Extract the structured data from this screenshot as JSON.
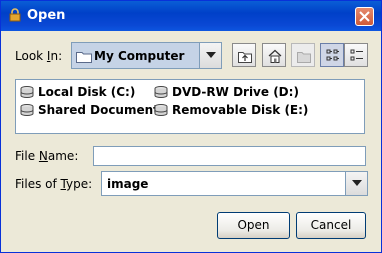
{
  "window": {
    "title": "Open",
    "accent": "#0a4bd4"
  },
  "lookin": {
    "label_pre": "Look ",
    "label_mn": "I",
    "label_post": "n:",
    "value": "My Computer"
  },
  "toolbar": {
    "icons": [
      "up-folder-icon",
      "home-icon",
      "new-folder-icon",
      "list-view-icon",
      "details-view-icon"
    ]
  },
  "files": [
    {
      "name": "Local Disk (C:)"
    },
    {
      "name": "Shared Documents"
    },
    {
      "name": "DVD-RW Drive (D:)"
    },
    {
      "name": "Removable Disk (E:)"
    }
  ],
  "filename": {
    "label_pre": "File ",
    "label_mn": "N",
    "label_post": "ame:",
    "value": ""
  },
  "filetype": {
    "label_pre": "Files of ",
    "label_mn": "T",
    "label_post": "ype:",
    "value": "image"
  },
  "buttons": {
    "open": "Open",
    "cancel": "Cancel"
  }
}
